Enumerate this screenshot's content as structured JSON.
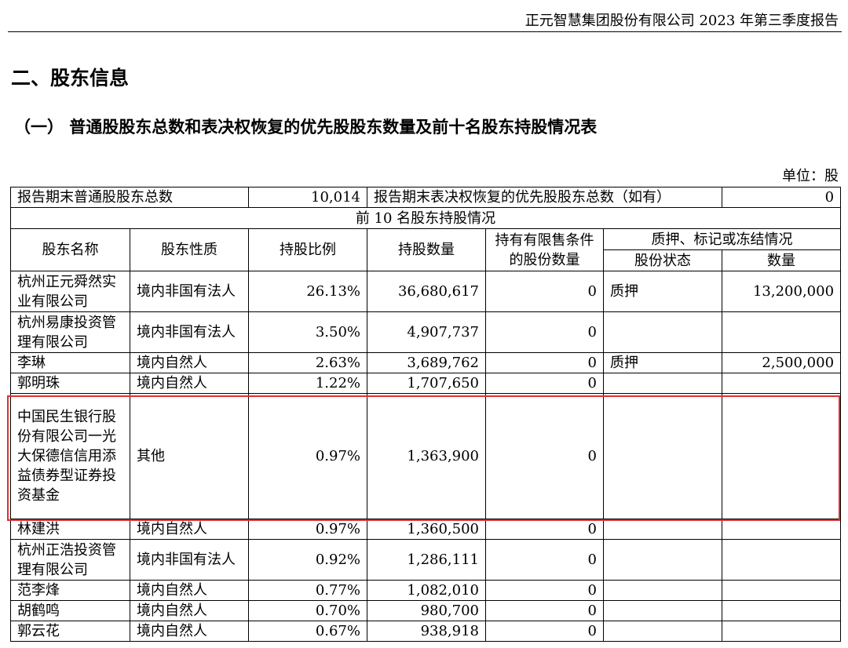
{
  "header": {
    "title": "正元智慧集团股份有限公司 2023 年第三季度报告"
  },
  "section_title": "二、股东信息",
  "subsection_title": "（一） 普通股股东总数和表决权恢复的优先股股东数量及前十名股东持股情况表",
  "unit_label": "单位：股",
  "summary": {
    "common_label": "报告期末普通股股东总数",
    "common_value": "10,014",
    "pref_label": "报告期末表决权恢复的优先股股东总数（如有）",
    "pref_value": "0"
  },
  "top10_title": "前 10 名股东持股情况",
  "columns": {
    "name": "股东名称",
    "nature": "股东性质",
    "ratio": "持股比例",
    "shares": "持股数量",
    "restricted": "持有有限售条件的股份数量",
    "pledge_group": "质押、标记或冻结情况",
    "pledge_status": "股份状态",
    "pledge_qty": "数量"
  },
  "rows": [
    {
      "name": "杭州正元舜然实业有限公司",
      "nature": "境内非国有法人",
      "ratio": "26.13%",
      "shares": "36,680,617",
      "restricted": "0",
      "status": "质押",
      "qty": "13,200,000"
    },
    {
      "name": "杭州易康投资管理有限公司",
      "nature": "境内非国有法人",
      "ratio": "3.50%",
      "shares": "4,907,737",
      "restricted": "0",
      "status": "",
      "qty": ""
    },
    {
      "name": "李琳",
      "nature": "境内自然人",
      "ratio": "2.63%",
      "shares": "3,689,762",
      "restricted": "0",
      "status": "质押",
      "qty": "2,500,000"
    },
    {
      "name": "郭明珠",
      "nature": "境内自然人",
      "ratio": "1.22%",
      "shares": "1,707,650",
      "restricted": "0",
      "status": "",
      "qty": ""
    },
    {
      "name": "中国民生银行股份有限公司一光大保德信信用添益债券型证券投资基金",
      "nature": "其他",
      "ratio": "0.97%",
      "shares": "1,363,900",
      "restricted": "0",
      "status": "",
      "qty": ""
    },
    {
      "name": "林建洪",
      "nature": "境内自然人",
      "ratio": "0.97%",
      "shares": "1,360,500",
      "restricted": "0",
      "status": "",
      "qty": ""
    },
    {
      "name": "杭州正浩投资管理有限公司",
      "nature": "境内非国有法人",
      "ratio": "0.92%",
      "shares": "1,286,111",
      "restricted": "0",
      "status": "",
      "qty": ""
    },
    {
      "name": "范李烽",
      "nature": "境内自然人",
      "ratio": "0.77%",
      "shares": "1,082,010",
      "restricted": "0",
      "status": "",
      "qty": ""
    },
    {
      "name": "胡鹤鸣",
      "nature": "境内自然人",
      "ratio": "0.70%",
      "shares": "980,700",
      "restricted": "0",
      "status": "",
      "qty": ""
    },
    {
      "name": "郭云花",
      "nature": "境内自然人",
      "ratio": "0.67%",
      "shares": "938,918",
      "restricted": "0",
      "status": "",
      "qty": ""
    }
  ]
}
